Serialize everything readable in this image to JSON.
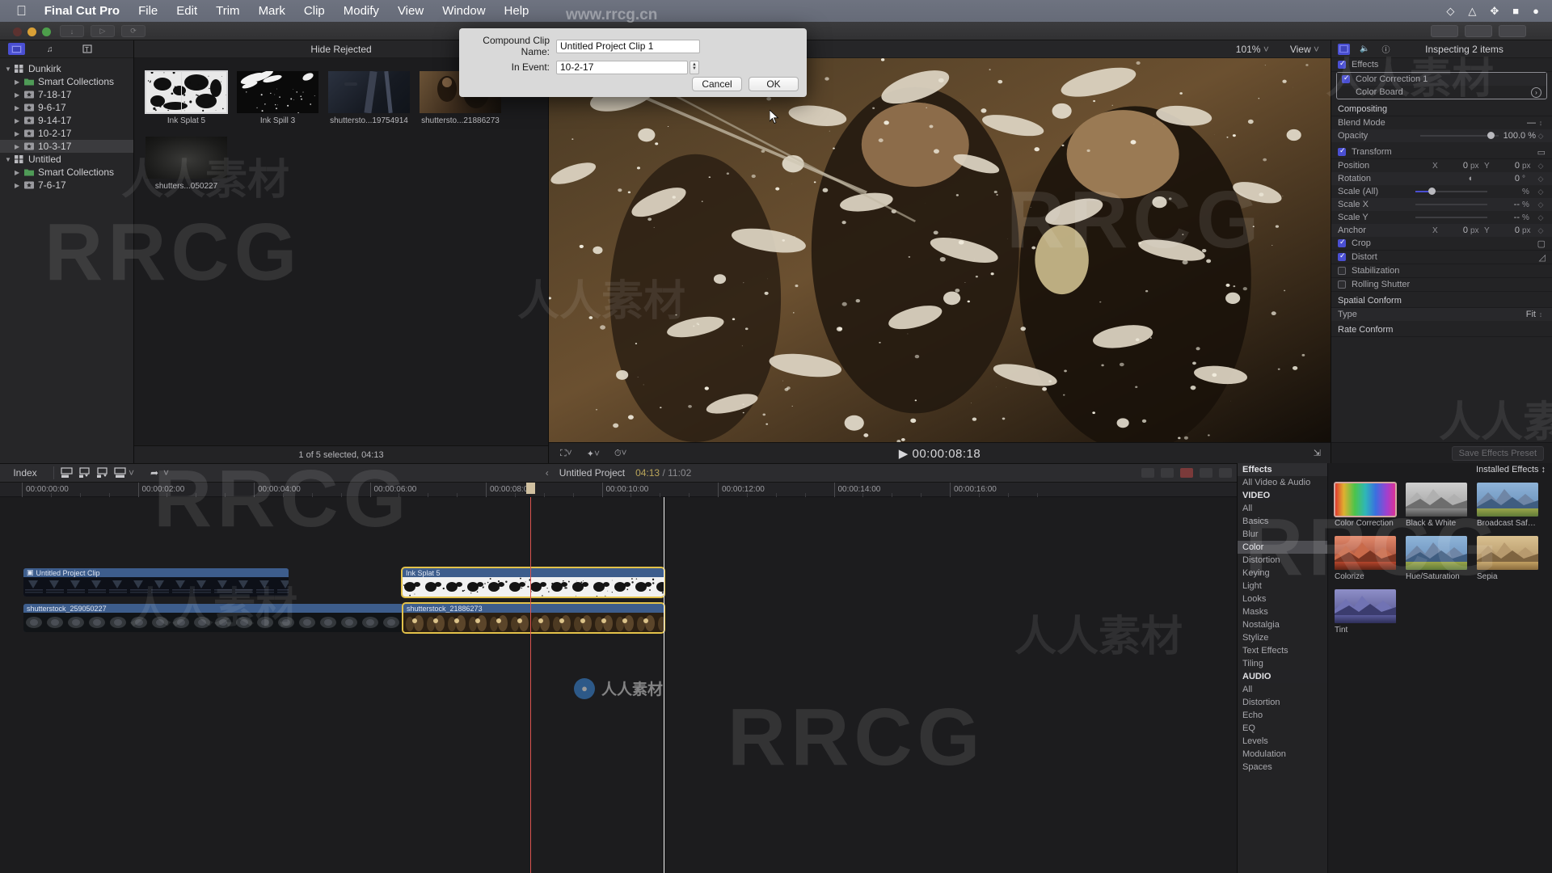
{
  "menubar": {
    "apple": "apple-logo",
    "items": [
      "Final Cut Pro",
      "File",
      "Edit",
      "Trim",
      "Mark",
      "Clip",
      "Modify",
      "View",
      "Window",
      "Help"
    ]
  },
  "dialog": {
    "name_label": "Compound Clip Name:",
    "name_value": "Untitled Project Clip 1",
    "event_label": "In Event:",
    "event_value": "10-2-17",
    "cancel": "Cancel",
    "ok": "OK"
  },
  "sidebar": {
    "items": [
      {
        "label": "Dunkirk",
        "level": 0,
        "icon": "library-icon",
        "expanded": true,
        "selected": false
      },
      {
        "label": "Smart Collections",
        "level": 1,
        "icon": "folder-icon",
        "expanded": false,
        "selected": false
      },
      {
        "label": "7-18-17",
        "level": 1,
        "icon": "event-icon",
        "expanded": false,
        "selected": false
      },
      {
        "label": "9-6-17",
        "level": 1,
        "icon": "event-icon",
        "expanded": false,
        "selected": false
      },
      {
        "label": "9-14-17",
        "level": 1,
        "icon": "event-icon",
        "expanded": false,
        "selected": false
      },
      {
        "label": "10-2-17",
        "level": 1,
        "icon": "event-icon",
        "expanded": false,
        "selected": false
      },
      {
        "label": "10-3-17",
        "level": 1,
        "icon": "event-icon",
        "expanded": false,
        "selected": true
      },
      {
        "label": "Untitled",
        "level": 0,
        "icon": "library-icon",
        "expanded": true,
        "selected": false
      },
      {
        "label": "Smart Collections",
        "level": 1,
        "icon": "folder-icon",
        "expanded": false,
        "selected": false
      },
      {
        "label": "7-6-17",
        "level": 1,
        "icon": "event-icon",
        "expanded": false,
        "selected": false
      }
    ]
  },
  "browser": {
    "hide_rejected": "Hide Rejected",
    "status": "1 of 5 selected, 04:13",
    "clips": [
      {
        "name": "Ink Splat 5",
        "thumb": "ink-splat",
        "selected": true
      },
      {
        "name": "Ink Spill 3",
        "thumb": "ink-spill",
        "selected": false
      },
      {
        "name": "shuttersto...19754914",
        "thumb": "dark-blue-scene",
        "selected": false
      },
      {
        "name": "shuttersto...21886273",
        "thumb": "warm-man-scene",
        "selected": false
      },
      {
        "name": "shutters...050227",
        "thumb": "dark-texture",
        "selected": false
      }
    ]
  },
  "viewer": {
    "zoom": "101%",
    "view_menu": "View",
    "timecode": "00:00:08:18",
    "play_icon": "play-icon"
  },
  "inspector": {
    "title": "Inspecting 2 items",
    "tabs": [
      "video-tab",
      "audio-tab",
      "info-tab"
    ],
    "save_preset": "Save Effects Preset",
    "sections": {
      "effects": {
        "label": "Effects",
        "checked": true
      },
      "color_correction": {
        "label": "Color Correction 1",
        "checked": true
      },
      "color_board": {
        "label": "Color Board"
      },
      "compositing": {
        "label": "Compositing"
      },
      "blend_mode": {
        "label": "Blend Mode",
        "value": "—"
      },
      "opacity": {
        "label": "Opacity",
        "value": "100.0 %"
      },
      "transform": {
        "label": "Transform",
        "checked": true
      },
      "position": {
        "label": "Position",
        "x": "0",
        "y": "0",
        "unit": "px"
      },
      "rotation": {
        "label": "Rotation",
        "value": "0",
        "unit": "°"
      },
      "scale_all": {
        "label": "Scale (All)",
        "value": "",
        "unit": "%"
      },
      "scale_x": {
        "label": "Scale X",
        "value": "--",
        "unit": "%"
      },
      "scale_y": {
        "label": "Scale Y",
        "value": "--",
        "unit": "%"
      },
      "anchor": {
        "label": "Anchor",
        "x": "0",
        "y": "0",
        "unit": "px"
      },
      "crop": {
        "label": "Crop",
        "checked": true
      },
      "distort": {
        "label": "Distort",
        "checked": true
      },
      "stabilization": {
        "label": "Stabilization",
        "checked": false
      },
      "rolling_shutter": {
        "label": "Rolling Shutter",
        "checked": false
      },
      "spatial_conform": {
        "label": "Spatial Conform"
      },
      "type": {
        "label": "Type",
        "value": "Fit"
      },
      "rate_conform": {
        "label": "Rate Conform"
      }
    },
    "axis_x": "X",
    "axis_y": "Y"
  },
  "timeline_toolbar": {
    "index": "Index",
    "icons": [
      "append-icon",
      "insert-icon",
      "connect-icon",
      "overwrite-icon",
      "tools-icon",
      "select-icon"
    ],
    "project_name": "Untitled Project",
    "current_time": "04:13",
    "total_time": "11:02",
    "separator": "/",
    "back_chevron": "chevron-left-icon",
    "forward_chevron": "chevron-right-icon"
  },
  "timeline": {
    "ruler_labels": [
      "00:00:00:00",
      "00:00:02:00",
      "00:00:04:00",
      "00:00:06:00",
      "00:00:08:00",
      "00:00:10:00",
      "00:00:12:00",
      "00:00:14:00",
      "00:00:16:00"
    ],
    "clips": [
      {
        "name": "Untitled Project Clip",
        "track": "connected",
        "selected": false,
        "kind": "compound"
      },
      {
        "name": "Ink Splat 5",
        "track": "connected",
        "selected": true,
        "kind": "video"
      },
      {
        "name": "shutterstock_259050227",
        "track": "primary",
        "selected": false,
        "kind": "video"
      },
      {
        "name": "shutterstock_21886273",
        "track": "primary",
        "selected": true,
        "kind": "video"
      }
    ]
  },
  "effects_browser": {
    "header": "Effects",
    "installed_label": "Installed Effects",
    "categories": [
      {
        "label": "All Video & Audio",
        "type": "item",
        "selected": false
      },
      {
        "label": "VIDEO",
        "type": "group",
        "selected": false
      },
      {
        "label": "All",
        "type": "item",
        "selected": false
      },
      {
        "label": "Basics",
        "type": "item",
        "selected": false
      },
      {
        "label": "Blur",
        "type": "item",
        "selected": false
      },
      {
        "label": "Color",
        "type": "item",
        "selected": true
      },
      {
        "label": "Distortion",
        "type": "item",
        "selected": false
      },
      {
        "label": "Keying",
        "type": "item",
        "selected": false
      },
      {
        "label": "Light",
        "type": "item",
        "selected": false
      },
      {
        "label": "Looks",
        "type": "item",
        "selected": false
      },
      {
        "label": "Masks",
        "type": "item",
        "selected": false
      },
      {
        "label": "Nostalgia",
        "type": "item",
        "selected": false
      },
      {
        "label": "Stylize",
        "type": "item",
        "selected": false
      },
      {
        "label": "Text Effects",
        "type": "item",
        "selected": false
      },
      {
        "label": "Tiling",
        "type": "item",
        "selected": false
      },
      {
        "label": "AUDIO",
        "type": "group",
        "selected": false
      },
      {
        "label": "All",
        "type": "item",
        "selected": false
      },
      {
        "label": "Distortion",
        "type": "item",
        "selected": false
      },
      {
        "label": "Echo",
        "type": "item",
        "selected": false
      },
      {
        "label": "EQ",
        "type": "item",
        "selected": false
      },
      {
        "label": "Levels",
        "type": "item",
        "selected": false
      },
      {
        "label": "Modulation",
        "type": "item",
        "selected": false
      },
      {
        "label": "Spaces",
        "type": "item",
        "selected": false
      }
    ],
    "effects": [
      {
        "label": "Color Correction",
        "style": "rainbow",
        "selected": true
      },
      {
        "label": "Black & White",
        "style": "bw",
        "selected": false
      },
      {
        "label": "Broadcast Safe ...",
        "style": "natural",
        "selected": false
      },
      {
        "label": "Colorize",
        "style": "colorize",
        "selected": false
      },
      {
        "label": "Hue/Saturation",
        "style": "natural",
        "selected": false
      },
      {
        "label": "Sepia",
        "style": "sepia",
        "selected": false
      },
      {
        "label": "Tint",
        "style": "tint",
        "selected": false
      }
    ]
  },
  "watermarks": {
    "top_url": "www.rrcg.cn",
    "cn_text": "人人素材",
    "rrcg": "RRCG",
    "brand": "人人素材"
  },
  "colors": {
    "accent": "#4a4fd2",
    "selection": "#e3c24a",
    "playhead": "#d9534f",
    "clip_blue": "#3d5d8c",
    "timecode": "#b9a45a"
  }
}
